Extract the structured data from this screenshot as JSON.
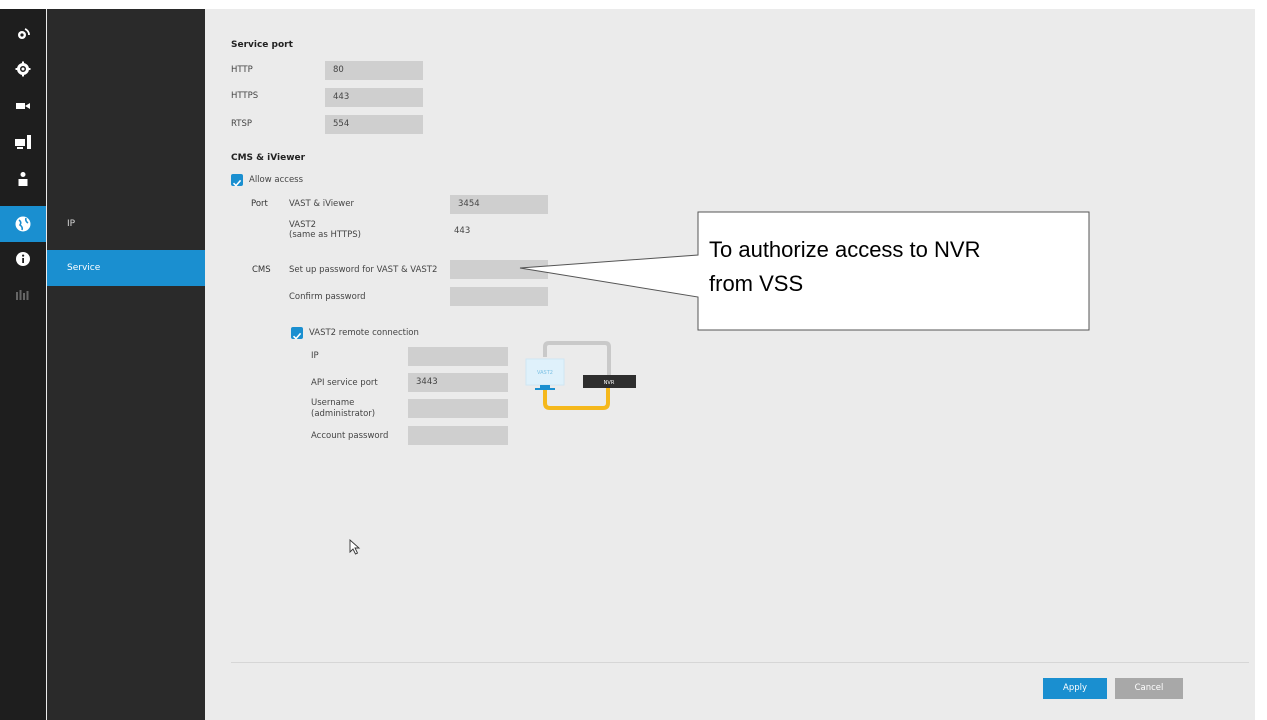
{
  "sidebar": {
    "icons": [
      "camera-logo-icon",
      "gear-icon",
      "video-camera-icon",
      "device-icon",
      "user-icon",
      "network-globe-icon",
      "info-icon",
      "log-bars-icon"
    ],
    "active_icon": "network-globe-icon"
  },
  "subnav": {
    "items": [
      {
        "label": "IP",
        "active": false
      },
      {
        "label": "Service",
        "active": true
      }
    ]
  },
  "service_port": {
    "title": "Service port",
    "rows": [
      {
        "label": "HTTP",
        "value": "80"
      },
      {
        "label": "HTTPS",
        "value": "443"
      },
      {
        "label": "RTSP",
        "value": "554"
      }
    ]
  },
  "cms": {
    "title": "CMS & iViewer",
    "allow_access_label": "Allow access",
    "allow_access_checked": true,
    "port_label": "Port",
    "vast_iviewer_label": "VAST & iViewer",
    "vast_iviewer_value": "3454",
    "vast2_label_line1": "VAST2",
    "vast2_label_line2": "(same as HTTPS)",
    "vast2_value": "443",
    "cms_label": "CMS",
    "setup_password_label": "Set up password for VAST & VAST2",
    "setup_password_value": "",
    "confirm_password_label": "Confirm password",
    "confirm_password_value": ""
  },
  "vast2_remote": {
    "label": "VAST2 remote connection",
    "checked": true,
    "ip_label": "IP",
    "ip_value": "",
    "api_port_label": "API service port",
    "api_port_value": "3443",
    "username_label_line1": "Username",
    "username_label_line2": "(administrator)",
    "username_value": "",
    "account_password_label": "Account password",
    "account_password_value": "",
    "diagram_monitor_label": "VAST2",
    "diagram_nvr_label": "NVR"
  },
  "footer": {
    "apply_label": "Apply",
    "cancel_label": "Cancel"
  },
  "callout": {
    "line1": "To authorize access to NVR",
    "line2": "from VSS"
  },
  "colors": {
    "accent": "#1a8fd0",
    "field_bg": "#cfcfcf",
    "page_bg": "#ebebeb",
    "sidebar_bg": "#1e1e1e",
    "subnav_bg": "#2a2a2a",
    "cancel_bg": "#a8a8a8",
    "diagram_cable_gray": "#c9c9c9",
    "diagram_cable_yellow": "#f5b81c"
  }
}
